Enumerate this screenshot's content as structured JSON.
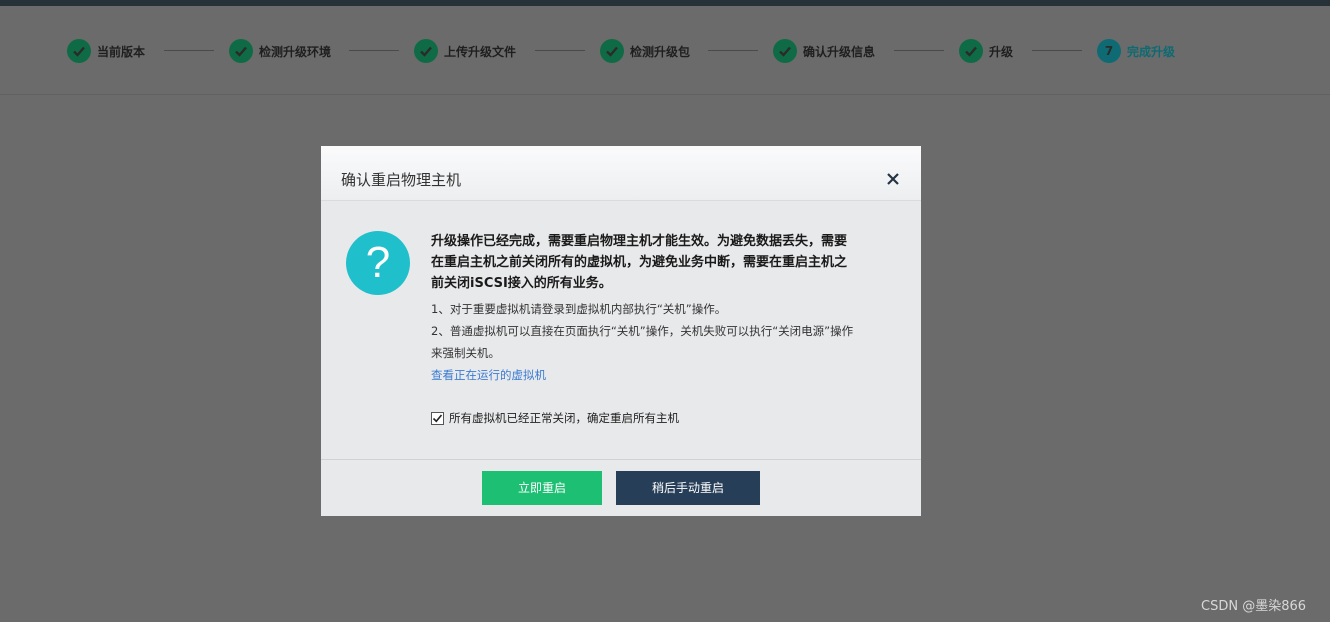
{
  "steps": [
    {
      "label": "当前版本",
      "status": "done"
    },
    {
      "label": "检测升级环境",
      "status": "done"
    },
    {
      "label": "上传升级文件",
      "status": "done"
    },
    {
      "label": "检测升级包",
      "status": "done"
    },
    {
      "label": "确认升级信息",
      "status": "done"
    },
    {
      "label": "升级",
      "status": "done"
    },
    {
      "label": "完成升级",
      "status": "current",
      "number": "7"
    }
  ],
  "dialog": {
    "title": "确认重启物理主机",
    "close_icon": "close-icon",
    "question_glyph": "?",
    "main_message": "升级操作已经完成，需要重启物理主机才能生效。为避免数据丢失，需要在重启主机之前关闭所有的虚拟机，为避免业务中断，需要在重启主机之前关闭iSCSI接入的所有业务。",
    "item1": "1、对于重要虚拟机请登录到虚拟机内部执行“关机”操作。",
    "item2": "2、普通虚拟机可以直接在页面执行“关机”操作，关机失败可以执行“关闭电源”操作来强制关机。",
    "link_text": "查看正在运行的虚拟机",
    "confirm_checked": true,
    "confirm_label": "所有虚拟机已经正常关闭，确定重启所有主机",
    "primary_button": "立即重启",
    "secondary_button": "稍后手动重启"
  },
  "watermark": "CSDN @墨染866",
  "colors": {
    "step_done": "#0f6b46",
    "step_current": "#0e6b74",
    "primary_button": "#1dbf73",
    "secondary_button": "#263e57",
    "question_icon": "#1fbfcb",
    "link": "#3b7bd4"
  }
}
